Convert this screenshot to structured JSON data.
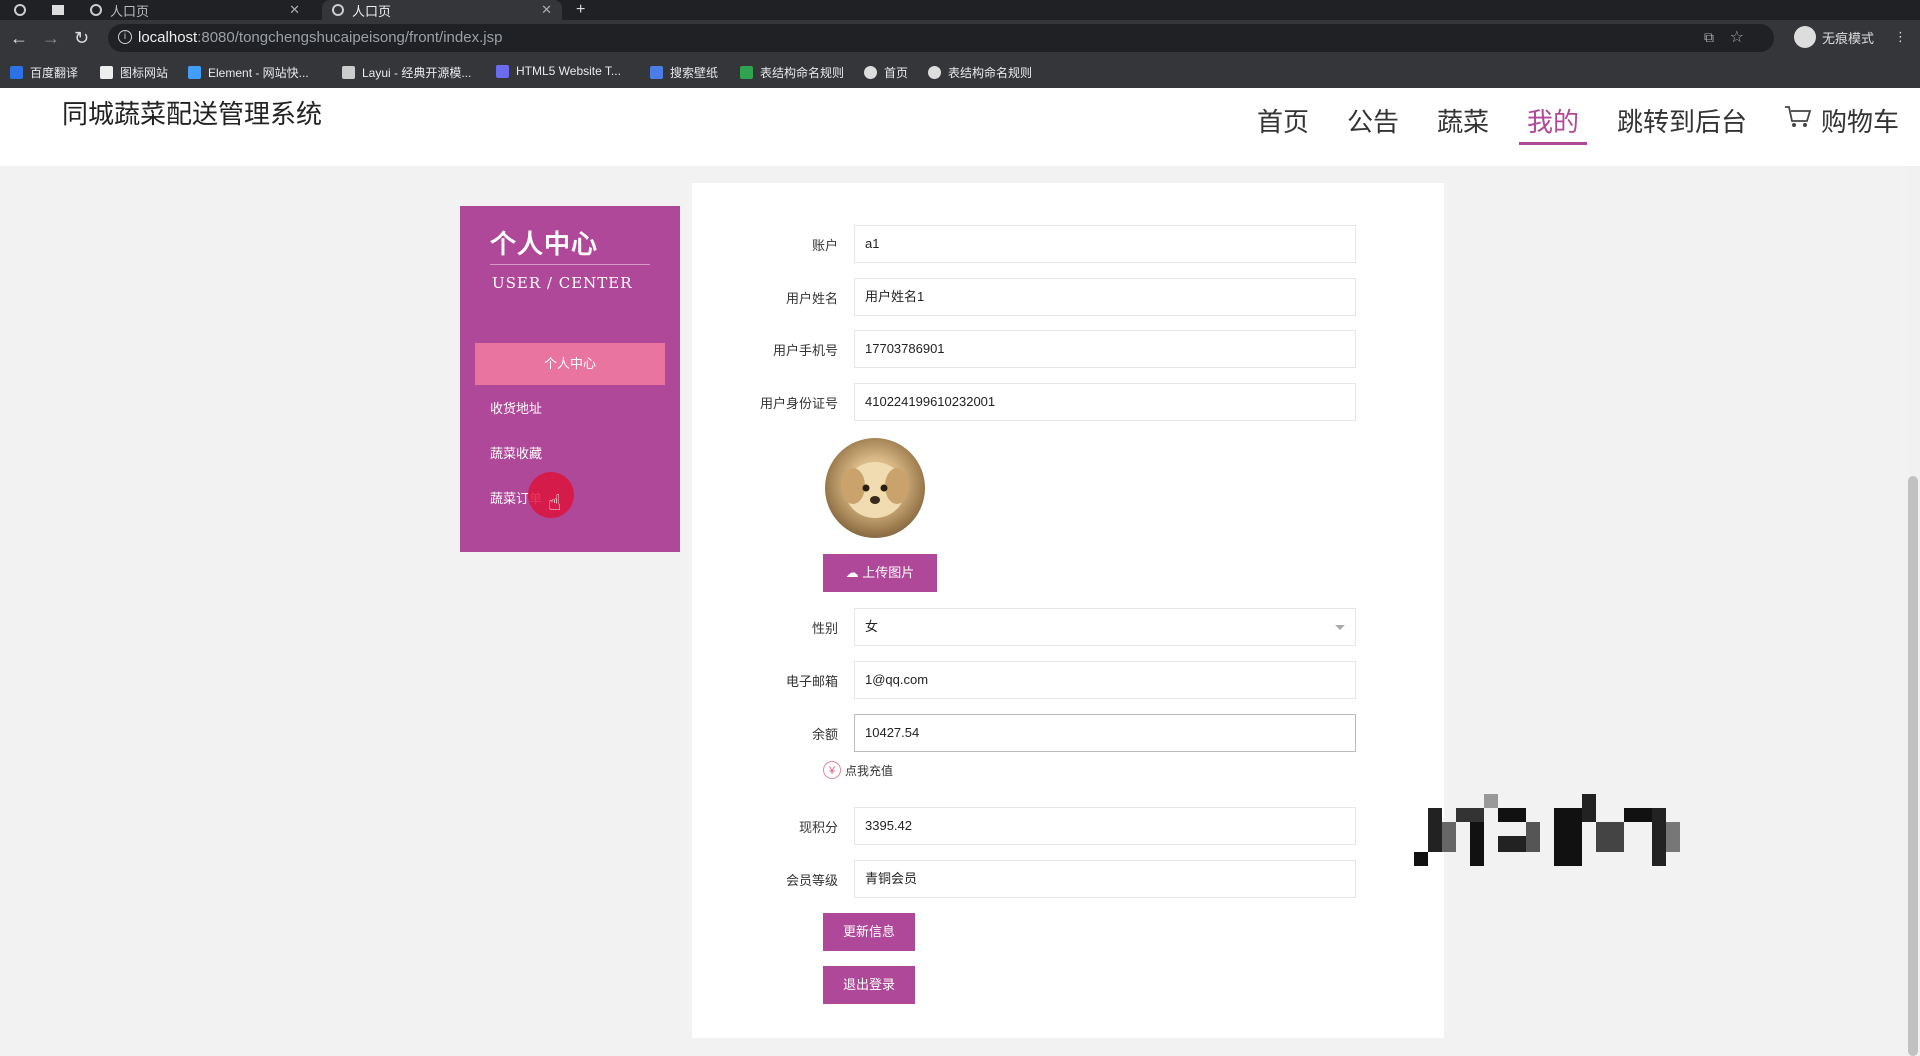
{
  "browser": {
    "tabs": [
      {
        "title": "人口页",
        "active": false
      },
      {
        "title": "人口页",
        "active": true
      }
    ],
    "new_tab": "+",
    "url_host": "localhost",
    "url_path": ":8080/tongchengshucaipeisong/front/index.jsp",
    "profile_label": "无痕模式",
    "bookmarks": [
      "百度翻译",
      "图标网站",
      "Element - 网站快...",
      "Layui - 经典开源模...",
      "HTML5 Website T...",
      "搜索壁纸",
      "表结构命名规则",
      "首页",
      "表结构命名规则"
    ]
  },
  "header": {
    "site_title": "同城蔬菜配送管理系统",
    "nav": [
      "首页",
      "公告",
      "蔬菜",
      "我的",
      "跳转到后台",
      "购物车"
    ],
    "active_nav": "我的"
  },
  "sidebar": {
    "title": "个人中心",
    "subtitle": "USER / CENTER",
    "items": [
      {
        "label": "个人中心",
        "active": true
      },
      {
        "label": "收货地址",
        "active": false
      },
      {
        "label": "蔬菜收藏",
        "active": false
      },
      {
        "label": "蔬菜订单",
        "active": false
      }
    ]
  },
  "form": {
    "account_label": "账户",
    "account_value": "a1",
    "name_label": "用户姓名",
    "name_value": "用户姓名1",
    "phone_label": "用户手机号",
    "phone_value": "17703786901",
    "idcard_label": "用户身份证号",
    "idcard_value": "410224199610232001",
    "upload_label": "上传图片",
    "gender_label": "性别",
    "gender_value": "女",
    "email_label": "电子邮箱",
    "email_value": "1@qq.com",
    "balance_label": "余额",
    "balance_value": "10427.54",
    "recharge_label": "点我充值",
    "points_label": "现积分",
    "points_value": "3395.42",
    "level_label": "会员等级",
    "level_value": "青铜会员",
    "update_label": "更新信息",
    "logout_label": "退出登录"
  },
  "colors": {
    "accent": "#b0489a",
    "active_item": "#e9749f"
  }
}
